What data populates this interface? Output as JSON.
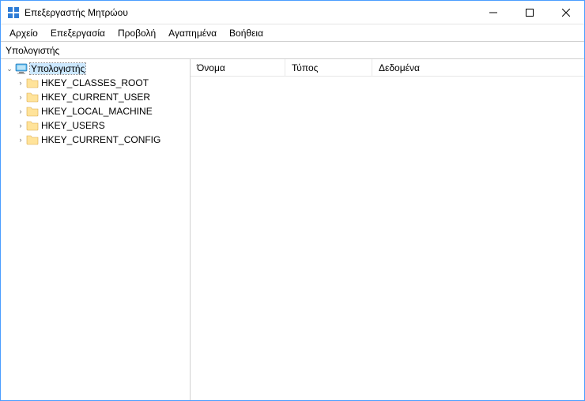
{
  "window": {
    "title": "Επεξεργαστής Μητρώου"
  },
  "menu": {
    "file": "Αρχείο",
    "edit": "Επεξεργασία",
    "view": "Προβολή",
    "favorites": "Αγαπημένα",
    "help": "Βοήθεια"
  },
  "address": "Υπολογιστής",
  "tree": {
    "root_label": "Υπολογιστής",
    "children": [
      {
        "label": "HKEY_CLASSES_ROOT"
      },
      {
        "label": "HKEY_CURRENT_USER"
      },
      {
        "label": "HKEY_LOCAL_MACHINE"
      },
      {
        "label": "HKEY_USERS"
      },
      {
        "label": "HKEY_CURRENT_CONFIG"
      }
    ]
  },
  "columns": {
    "name": "Όνομα",
    "type": "Τύπος",
    "data": "Δεδομένα"
  }
}
